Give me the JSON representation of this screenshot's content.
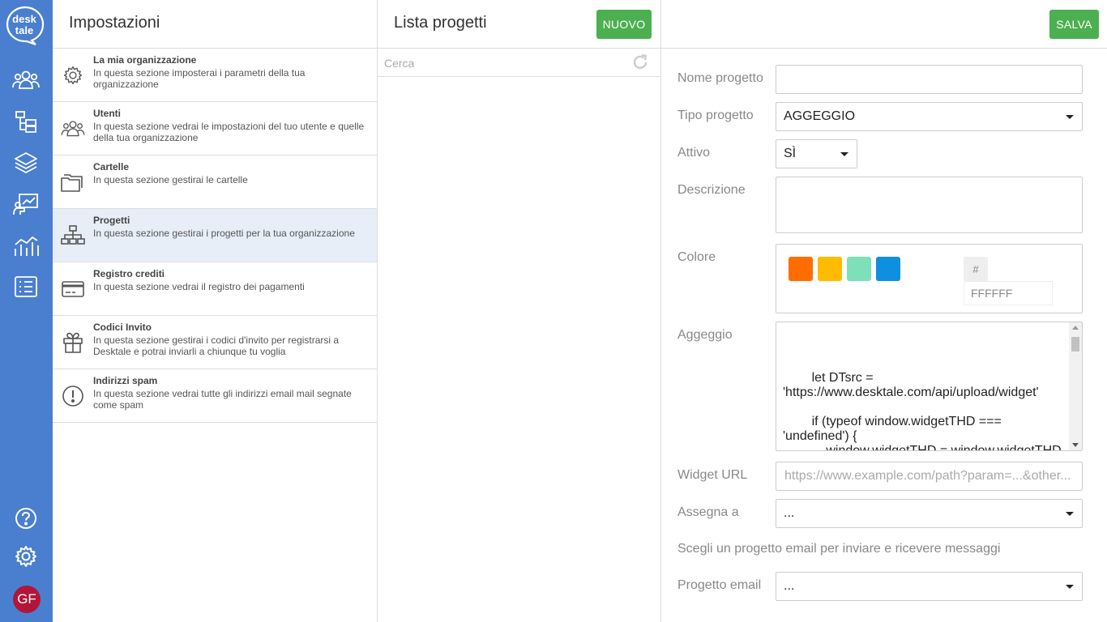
{
  "brand": {
    "logo_line1": "desk",
    "logo_line2": "tale",
    "avatar_initials": "GF"
  },
  "rail": {
    "items": [
      {
        "icon": "team-icon"
      },
      {
        "icon": "folders-tree-icon"
      },
      {
        "icon": "layers-icon"
      },
      {
        "icon": "presentation-icon"
      },
      {
        "icon": "analytics-icon"
      },
      {
        "icon": "list-icon"
      }
    ],
    "bottom": [
      {
        "icon": "help-icon"
      },
      {
        "icon": "gear-icon"
      }
    ]
  },
  "settings": {
    "title": "Impostazioni",
    "items": [
      {
        "title": "La mia organizzazione",
        "desc": "In questa sezione imposterai i parametri della tua organizzazione",
        "icon": "gear-icon"
      },
      {
        "title": "Utenti",
        "desc": "In questa sezione vedrai le impostazioni del tuo utente e quelle della tua organizzazione",
        "icon": "users-icon"
      },
      {
        "title": "Cartelle",
        "desc": "In questa sezione gestirai le cartelle",
        "icon": "folder-icon"
      },
      {
        "title": "Progetti",
        "desc": "In questa sezione gestirai i progetti per la tua organizzazione",
        "icon": "sitemap-icon",
        "active": true
      },
      {
        "title": "Registro crediti",
        "desc": "In questa sezione vedrai il registro dei pagamenti",
        "icon": "credit-card-icon"
      },
      {
        "title": "Codici Invito",
        "desc": "In questa sezione gestirai i codici d'invito per registrarsi a Desktale e potrai inviarli a chiunque tu voglia",
        "icon": "gift-icon"
      },
      {
        "title": "Indirizzi spam",
        "desc": "In questa sezione vedrai tutte gli indirizzi email mail segnate come spam",
        "icon": "alert-circle-icon"
      }
    ]
  },
  "projects": {
    "title": "Lista progetti",
    "new_label": "NUOVO",
    "search_placeholder": "Cerca"
  },
  "form": {
    "save_label": "SALVA",
    "name_label": "Nome progetto",
    "name_value": "",
    "type_label": "Tipo progetto",
    "type_value": "AGGEGGIO",
    "active_label": "Attivo",
    "active_value": "SÌ",
    "desc_label": "Descrizione",
    "desc_value": "",
    "color_label": "Colore",
    "swatches": [
      "#ff6d00",
      "#ffbb00",
      "#7de0b8",
      "#0f8fe0"
    ],
    "hash": "#",
    "hex_value": "FFFFFF",
    "widget_label": "Aggeggio",
    "widget_code": "\n\t\tlet DTsrc = 'https://www.desktale.com/api/upload/widget'\n\n\t\tif (typeof window.widgetTHD === 'undefined') {\n\t\t\twindow.widgetTHD = window.widgetTHD || {};\n\t\t\t(function () {",
    "widget_url_label": "Widget URL",
    "widget_url_placeholder": "https://www.example.com/path?param=...&other...",
    "assign_label": "Assegna a",
    "assign_value": "...",
    "email_hint": "Scegli un progetto email per inviare e ricevere messaggi",
    "email_project_label": "Progetto email",
    "email_project_value": "..."
  }
}
